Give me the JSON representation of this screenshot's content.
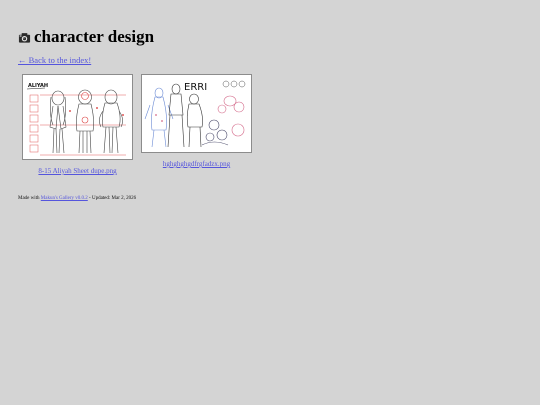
{
  "page": {
    "title": "character design",
    "back_link": "← Back to the index!"
  },
  "gallery": {
    "items": [
      {
        "filename": "8-15 Aliyah Sheet dupe.png",
        "sketch_label": "ALIYAH"
      },
      {
        "filename": "hghghghgdfrgfadzx.png",
        "sketch_label": "ERRI"
      }
    ]
  },
  "footer": {
    "made_with": "Made with",
    "generator": "Makun's Gallery v0.0.2",
    "updated": " - Updated: Mar 2, 2026"
  },
  "colors": {
    "background": "#d4d4d4",
    "link": "#5555dd"
  }
}
